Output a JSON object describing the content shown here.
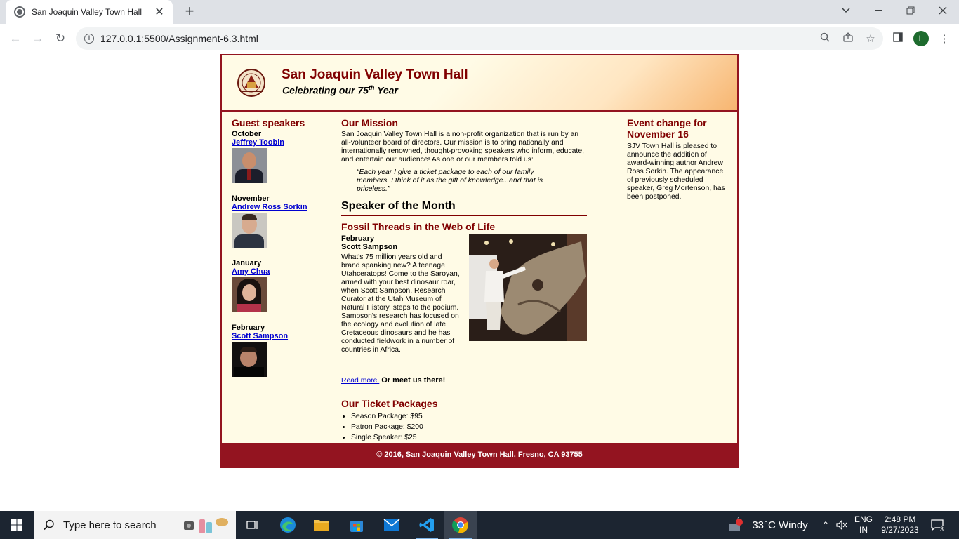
{
  "browser": {
    "tab_title": "San Joaquin Valley Town Hall",
    "new_tab_icon": "plus-icon",
    "url": "127.0.0.1:5500/Assignment-6.3.html",
    "profile_initial": "L"
  },
  "site": {
    "title": "San Joaquin Valley Town Hall",
    "subtitle_pre": "Celebrating our",
    "subtitle_num": "75",
    "subtitle_sup": "th",
    "subtitle_post": "Year"
  },
  "guest_speakers": {
    "heading": "Guest speakers",
    "items": [
      {
        "month": "October",
        "name": "Jeffrey Toobin"
      },
      {
        "month": "November",
        "name": "Andrew Ross Sorkin"
      },
      {
        "month": "January",
        "name": "Amy Chua"
      },
      {
        "month": "February",
        "name": "Scott Sampson"
      }
    ]
  },
  "mission": {
    "heading": "Our Mission",
    "text": "San Joaquin Valley Town Hall is a non-profit organization that is run by an all-volunteer board of directors. Our mission is to bring nationally and internationally renowned, thought-provoking speakers who inform, educate, and entertain our audience! As one or our members told us:",
    "quote": "“Each year I give a ticket package to each of our family members. I think of it as the gift of knowledge...and that is priceless.”"
  },
  "speaker_of_month": {
    "heading": "Speaker of the Month",
    "lecture_title": "Fossil Threads in the Web of Life",
    "month": "February",
    "speaker": "Scott Sampson",
    "text": "What's 75 million years old and brand spanking new? A teenage Utahceratops! Come to the Saroyan, armed with your best dinosaur roar, when Scott Sampson, Research Curator at the Utah Museum of Natural History, steps to the podium. Sampson's research has focused on the ecology and evolution of late Cretaceous dinosaurs and he has conducted fieldwork in a number of countries in Africa.",
    "read_more": "Read more.",
    "meet_us": "Or meet us there!"
  },
  "tickets": {
    "heading": "Our Ticket Packages",
    "items": [
      "Season Package: $95",
      "Patron Package: $200",
      "Single Speaker: $25"
    ]
  },
  "event_change": {
    "heading": "Event change for November 16",
    "text": "SJV Town Hall is pleased to announce the addition of award-winning author Andrew Ross Sorkin. The appearance of previously scheduled speaker, Greg Mortenson, has been postponed."
  },
  "footer": {
    "text": "© 2016, San Joaquin Valley Town Hall, Fresno, CA 93755"
  },
  "taskbar": {
    "search_placeholder": "Type here to search",
    "weather": "33°C  Windy",
    "notif_count": "1",
    "lang_line1": "ENG",
    "lang_line2": "IN",
    "time": "2:48 PM",
    "date": "9/27/2023",
    "action_center_count": "3"
  }
}
